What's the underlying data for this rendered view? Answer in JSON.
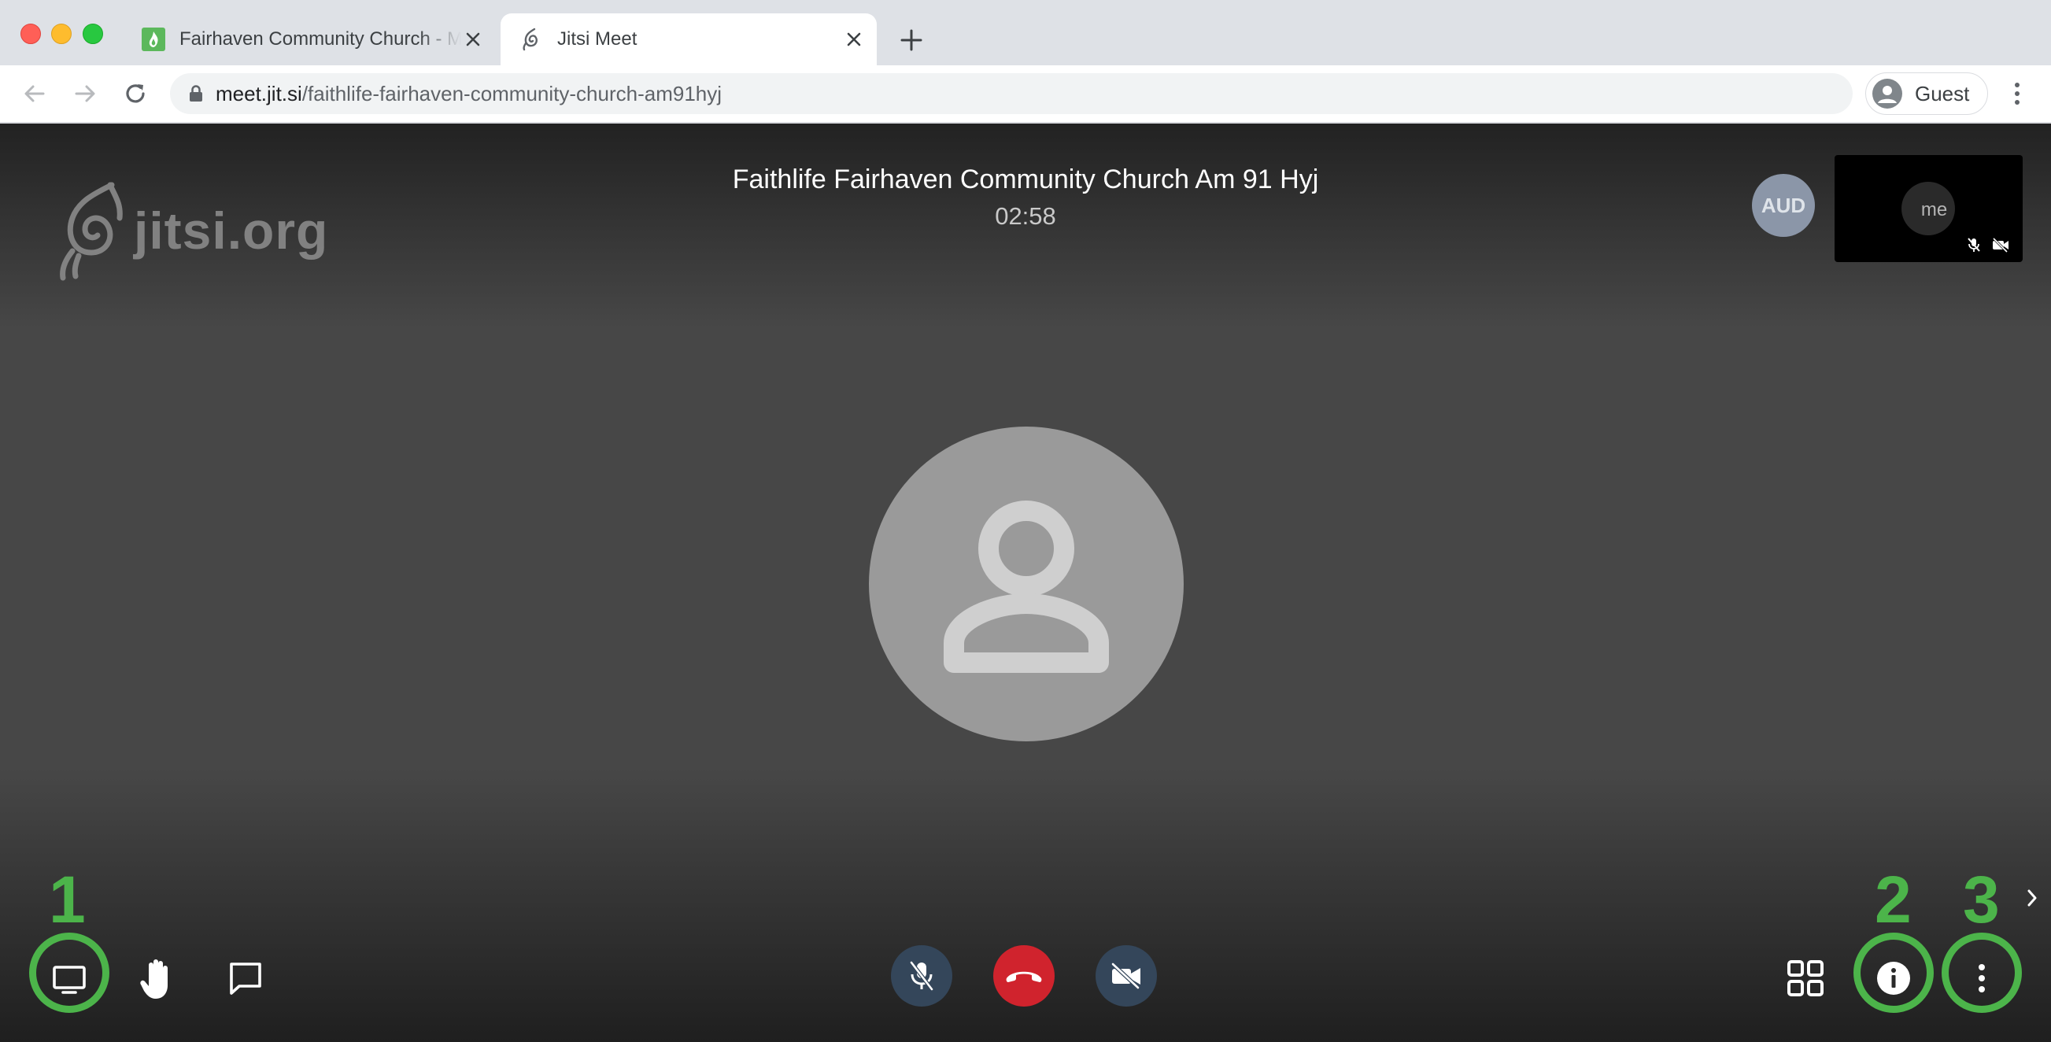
{
  "browser": {
    "tabs": [
      {
        "title": "Fairhaven Community Church - M",
        "favicon": "church-flame-icon",
        "active": false
      },
      {
        "title": "Jitsi Meet",
        "favicon": "jitsi-icon",
        "active": true
      }
    ],
    "url_host": "meet.jit.si",
    "url_path": "/faithlife-fairhaven-community-church-am91hyj",
    "profile_label": "Guest"
  },
  "meeting": {
    "logo_text": "jitsi.org",
    "title": "Faithlife Fairhaven Community Church Am 91 Hyj",
    "timer": "02:58",
    "participant_badge": "AUD",
    "self_label": "me"
  },
  "toolbar": {
    "left": [
      "desktop-share-icon",
      "raise-hand-icon",
      "chat-icon"
    ],
    "center": [
      "mic-muted-icon",
      "hangup-icon",
      "camera-off-icon"
    ],
    "right": [
      "tile-view-icon",
      "info-icon",
      "more-options-icon"
    ]
  },
  "annotations": {
    "labels": [
      "1",
      "2",
      "3"
    ],
    "color": "#4cb44a"
  },
  "colors": {
    "hangup": "#d0232d",
    "muted_button": "#34465a",
    "annotation": "#4cb44a"
  }
}
